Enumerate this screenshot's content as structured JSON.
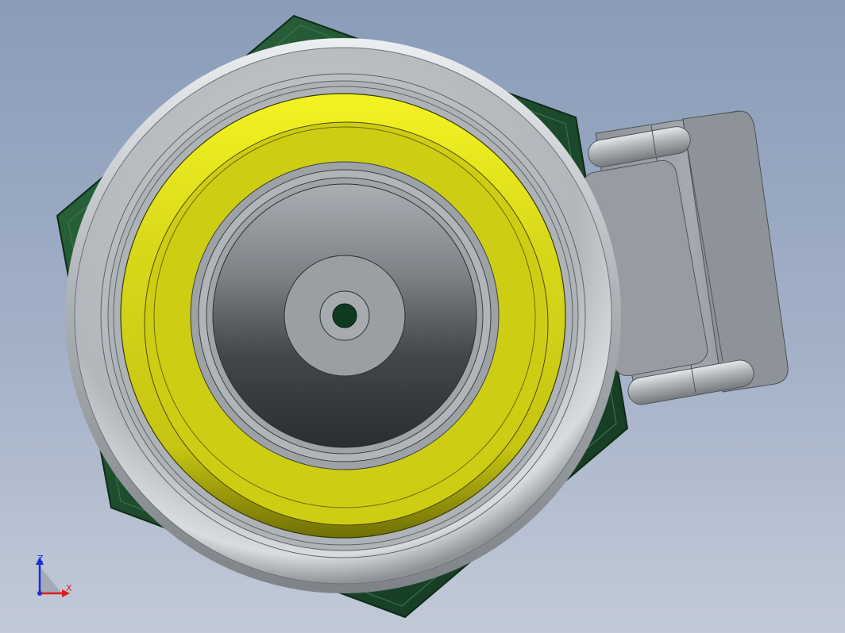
{
  "viewport": {
    "background_top": "#8a9cb9",
    "background_bottom": "#c2cad7"
  },
  "model": {
    "parts": [
      "hex-base",
      "tire",
      "yellow-wheel-band",
      "conical-hub",
      "axle-hole",
      "swivel-bracket"
    ],
    "colors": {
      "hex_base": "#1d4a2c",
      "tire": "#b4b9bf",
      "yellow_band": "#d8d818",
      "hub_light": "#b0b6bc",
      "hub_dark": "#303236",
      "axle_hole": "#0f3a1f",
      "bracket": "#9ea3a9"
    }
  },
  "triad": {
    "z_label": "Z",
    "x_label": "X",
    "z_color": "#1a2ed8",
    "x_color": "#e01c1c"
  }
}
